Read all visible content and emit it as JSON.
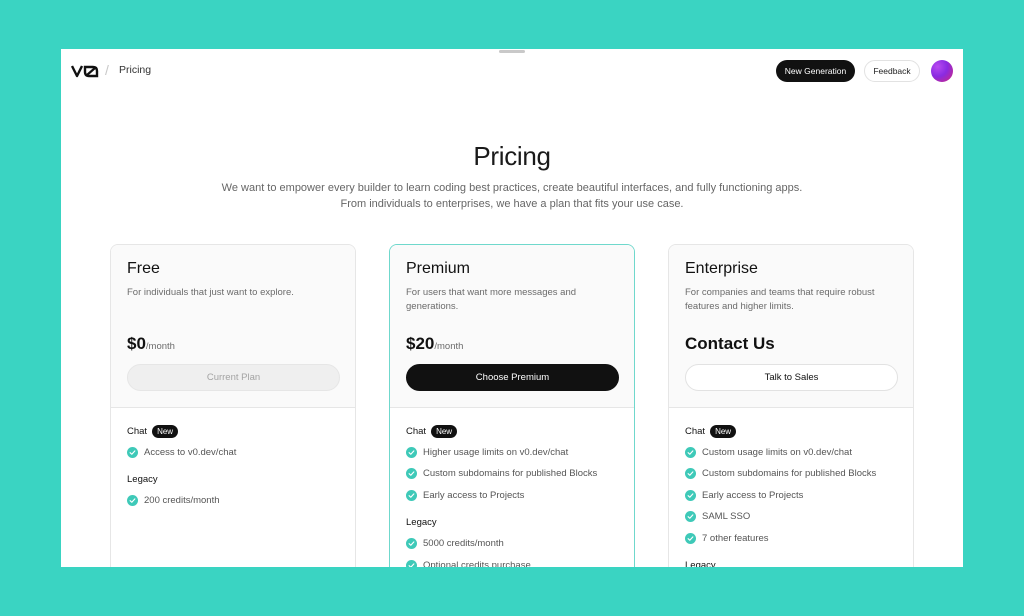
{
  "header": {
    "logo_text": "v0",
    "breadcrumb_separator": "/",
    "breadcrumb": "Pricing",
    "new_generation_label": "New Generation",
    "feedback_label": "Feedback"
  },
  "hero": {
    "title": "Pricing",
    "subtitle": "We want to empower every builder to learn coding best practices, create beautiful interfaces, and fully functioning apps. From individuals to enterprises, we have a plan that fits your use case."
  },
  "icons": {
    "check": "check-circle-icon",
    "avatar": "user-avatar"
  },
  "colors": {
    "background": "#3ad4c2",
    "check": "#3ec9b8",
    "highlight_border": "#6fd8cc",
    "primary_button": "#111111"
  },
  "plans": [
    {
      "name": "Free",
      "description": "For individuals that just want to explore.",
      "price": "$0",
      "per": "/month",
      "cta": "Current Plan",
      "sections": [
        {
          "title": "Chat",
          "badge": "New",
          "features": [
            "Access to v0.dev/chat"
          ]
        },
        {
          "title": "Legacy",
          "badge": "",
          "features": [
            "200 credits/month"
          ]
        }
      ]
    },
    {
      "name": "Premium",
      "description": "For users that want more messages and generations.",
      "price": "$20",
      "per": "/month",
      "cta": "Choose Premium",
      "sections": [
        {
          "title": "Chat",
          "badge": "New",
          "features": [
            "Higher usage limits on v0.dev/chat",
            "Custom subdomains for published Blocks",
            "Early access to Projects"
          ]
        },
        {
          "title": "Legacy",
          "badge": "",
          "features": [
            "5000 credits/month",
            "Optional credits purchase"
          ]
        }
      ]
    },
    {
      "name": "Enterprise",
      "description": "For companies and teams that require robust features and higher limits.",
      "price": "Contact Us",
      "per": "",
      "cta": "Talk to Sales",
      "sections": [
        {
          "title": "Chat",
          "badge": "New",
          "features": [
            "Custom usage limits on v0.dev/chat",
            "Custom subdomains for published Blocks",
            "Early access to Projects",
            "SAML SSO",
            "7 other features"
          ]
        },
        {
          "title": "Legacy",
          "badge": "",
          "features": []
        }
      ]
    }
  ]
}
